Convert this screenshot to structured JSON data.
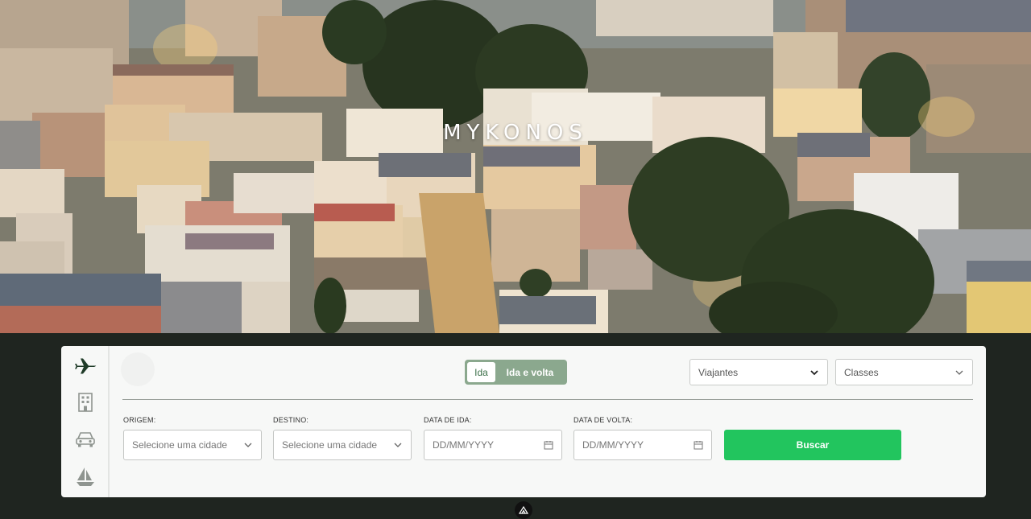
{
  "hero": {
    "title": "MYKONOS",
    "image": "town-at-dusk-photo"
  },
  "colors": {
    "accent": "#22c55e",
    "toggle_bg": "#8ba88e",
    "page_bg": "#1f2520",
    "icon_dark": "#1f3b28"
  },
  "side_nav": {
    "items": [
      {
        "icon": "airplane-icon",
        "active": true
      },
      {
        "icon": "building-icon",
        "active": false
      },
      {
        "icon": "car-icon",
        "active": false
      },
      {
        "icon": "sailboat-icon",
        "active": false
      }
    ]
  },
  "trip_toggle": {
    "option_one": "Ida",
    "option_two": "Ida e volta",
    "selected": "Ida"
  },
  "travelers_select": {
    "value": "Viajantes"
  },
  "class_select": {
    "value": "Classes"
  },
  "form": {
    "origin": {
      "label": "ORIGEM:",
      "placeholder": "Selecione uma cidade"
    },
    "destination": {
      "label": "DESTINO:",
      "placeholder": "Selecione uma cidade"
    },
    "departure": {
      "label": "DATA DE IDA:",
      "placeholder": "DD/MM/YYYY"
    },
    "return": {
      "label": "DATA DE VOLTA:",
      "placeholder": "DD/MM/YYYY"
    },
    "search_label": "Buscar"
  }
}
